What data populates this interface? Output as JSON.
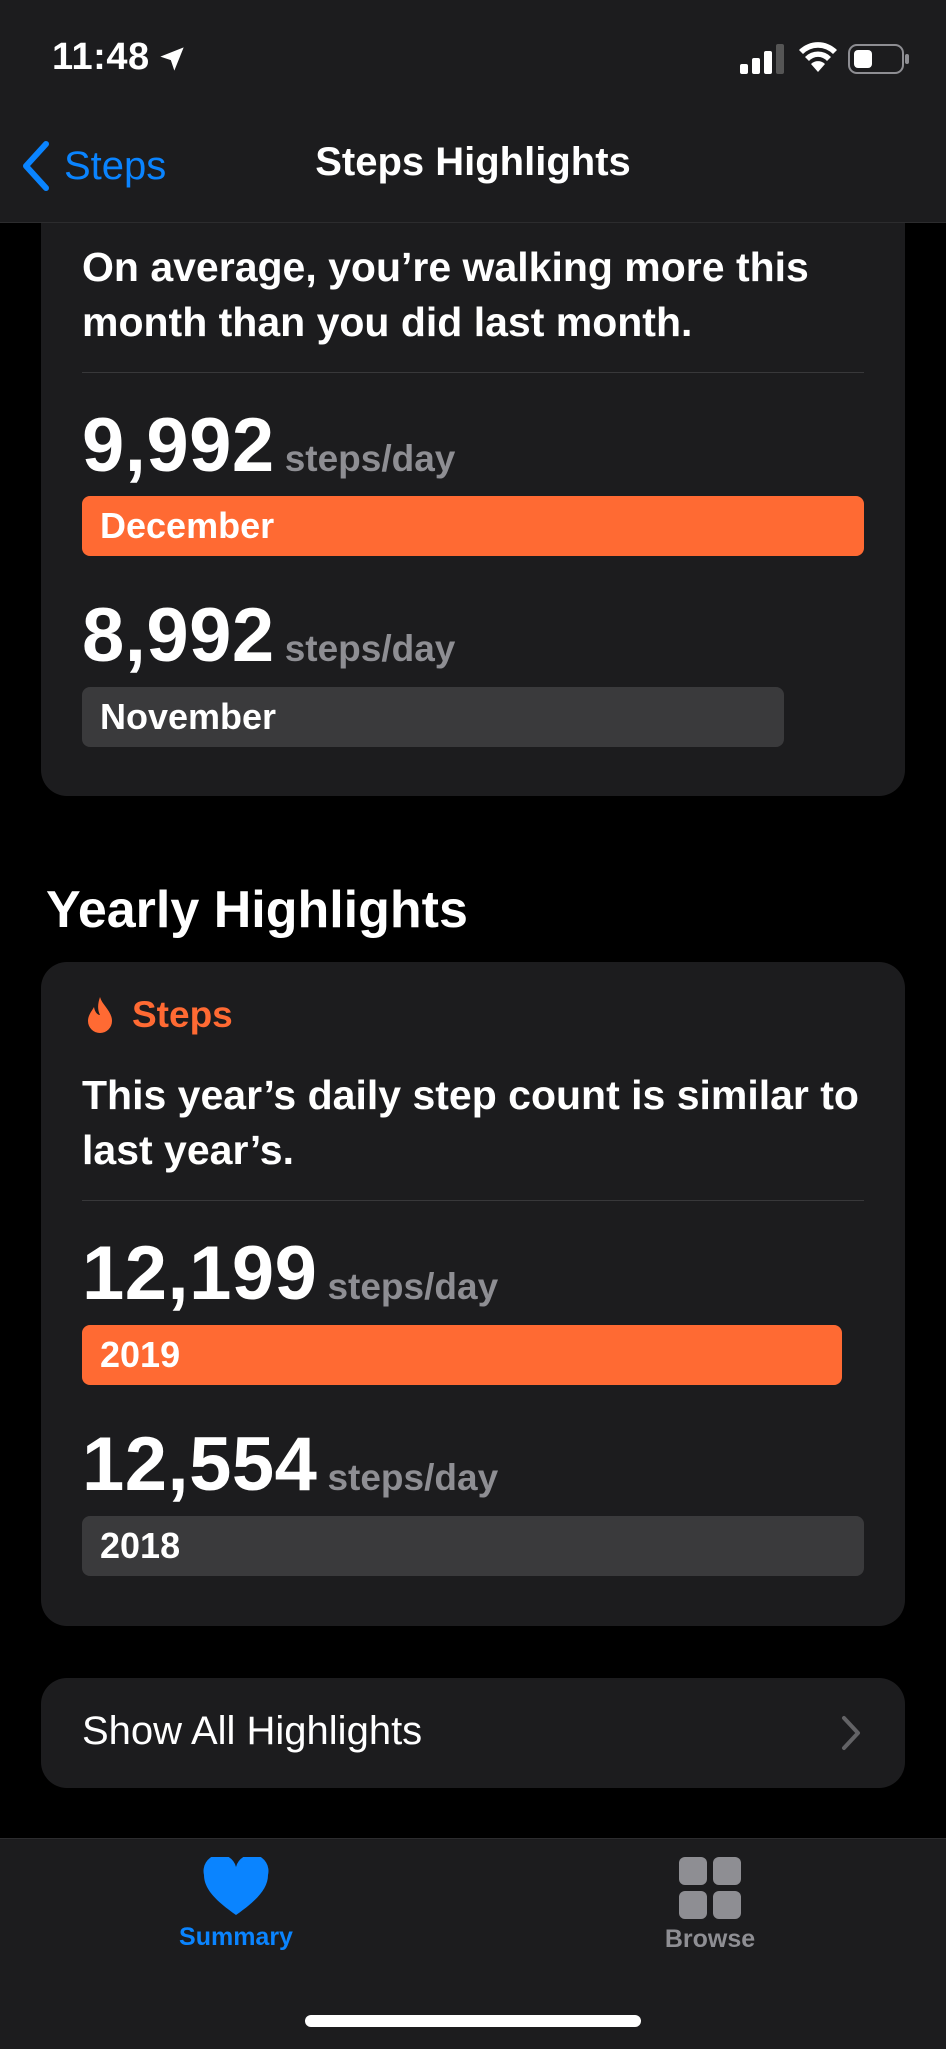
{
  "status_bar": {
    "time": "11:48"
  },
  "nav": {
    "back_label": "Steps",
    "title": "Steps Highlights"
  },
  "monthly": {
    "insight": "On average, you’re walking more this month than you did last month.",
    "current": {
      "value": "9,992",
      "unit": "steps/day",
      "label": "December"
    },
    "previous": {
      "value": "8,992",
      "unit": "steps/day",
      "label": "November"
    }
  },
  "yearly": {
    "section_title": "Yearly Highlights",
    "category": "Steps",
    "insight": "This year’s daily step count is similar to last year’s.",
    "current": {
      "value": "12,199",
      "unit": "steps/day",
      "label": "2019"
    },
    "previous": {
      "value": "12,554",
      "unit": "steps/day",
      "label": "2018"
    }
  },
  "show_all": {
    "label": "Show All Highlights"
  },
  "tabbar": {
    "items": [
      {
        "label": "Summary",
        "icon": "heart-icon",
        "active": true
      },
      {
        "label": "Browse",
        "icon": "grid-icon",
        "active": false
      }
    ]
  },
  "colors": {
    "accent": "#0a84ff",
    "highlight": "#ff6a33",
    "card": "#1c1c1e",
    "muted_bar": "#3a3a3c"
  }
}
